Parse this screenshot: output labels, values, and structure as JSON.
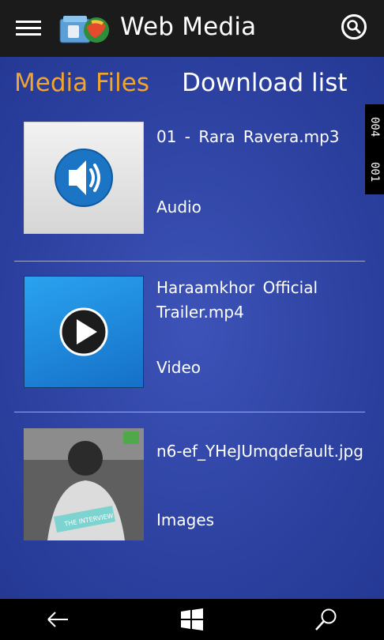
{
  "app": {
    "title": "Web Media"
  },
  "tabs": [
    {
      "label": "Media Files",
      "active": true
    },
    {
      "label": "Download list",
      "active": false
    }
  ],
  "side_counter": {
    "top": "004",
    "bottom": "001"
  },
  "media_items": [
    {
      "name": "01 - Rara Ravera.mp3",
      "type": "Audio",
      "thumb_icon": "speaker-icon"
    },
    {
      "name": "Haraamkhor  Official Trailer.mp4",
      "type": "Video",
      "thumb_icon": "play-icon"
    },
    {
      "name": "n6-ef_YHeJUmqdefault.jpg",
      "type": "Images",
      "thumb_icon": "photo-thumbnail",
      "thumb_caption": "THE INTERVIEW"
    }
  ],
  "colors": {
    "active_tab": "#f2a52e",
    "background": "#2e43a2",
    "topbar": "#1b1b1b"
  }
}
